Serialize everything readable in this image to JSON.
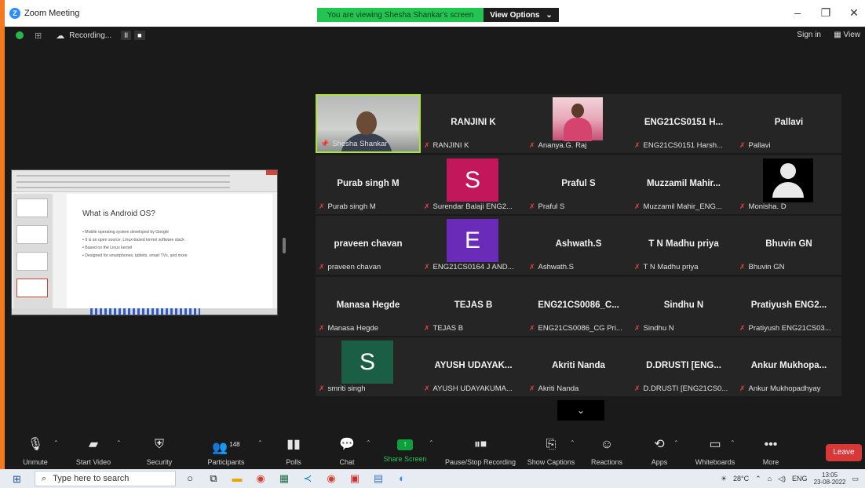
{
  "window": {
    "title": "Zoom Meeting",
    "viewing_banner": "You are viewing Shesha Shankar's screen",
    "view_options": "View Options",
    "controls": {
      "minimize": "–",
      "maximize": "❐",
      "close": "✕"
    }
  },
  "status": {
    "recording": "Recording...",
    "pause": "II",
    "stop": "■",
    "signin": "Sign in",
    "view": "View"
  },
  "shared_screen": {
    "slide_title": "What is Android OS?",
    "bullets": [
      "Mobile operating system developed by Google",
      "It is an open source, Linux-based kernel software stack",
      "Based on the Linux kernel",
      "Designed for smartphones, tablets, smart TVs, and more"
    ]
  },
  "participants": [
    {
      "name": "",
      "label": "Shesha Shankar",
      "type": "video-person",
      "active": true
    },
    {
      "name": "RANJINI K",
      "label": "RANJINI K",
      "type": "name"
    },
    {
      "name": "",
      "label": "Ananya.G. Raj",
      "type": "video-small"
    },
    {
      "name": "ENG21CS0151 H...",
      "label": "ENG21CS0151 Harsh...",
      "type": "name"
    },
    {
      "name": "Pallavi",
      "label": "Pallavi",
      "type": "name"
    },
    {
      "name": "Purab singh M",
      "label": "Purab singh M",
      "type": "name"
    },
    {
      "name": "S",
      "label": "Surendar Balaji ENG2...",
      "type": "letter",
      "color": "#c2185b"
    },
    {
      "name": "Praful S",
      "label": "Praful S",
      "type": "name"
    },
    {
      "name": "Muzzamil Mahir...",
      "label": "Muzzamil Mahir_ENG...",
      "type": "name"
    },
    {
      "name": "",
      "label": "Monisha. D",
      "type": "silhouette"
    },
    {
      "name": "praveen chavan",
      "label": "praveen chavan",
      "type": "name"
    },
    {
      "name": "E",
      "label": "ENG21CS0164 J AND...",
      "type": "letter",
      "color": "#6a2bb8"
    },
    {
      "name": "Ashwath.S",
      "label": "Ashwath.S",
      "type": "name"
    },
    {
      "name": "T N Madhu priya",
      "label": "T N Madhu priya",
      "type": "name"
    },
    {
      "name": "Bhuvin GN",
      "label": "Bhuvin GN",
      "type": "name"
    },
    {
      "name": "Manasa Hegde",
      "label": "Manasa Hegde",
      "type": "name"
    },
    {
      "name": "TEJAS B",
      "label": "TEJAS B",
      "type": "name"
    },
    {
      "name": "ENG21CS0086_C...",
      "label": "ENG21CS0086_CG Pri...",
      "type": "name"
    },
    {
      "name": "Sindhu N",
      "label": "Sindhu N",
      "type": "name"
    },
    {
      "name": "Pratiyush ENG2...",
      "label": "Pratiyush ENG21CS03...",
      "type": "name"
    },
    {
      "name": "S",
      "label": "smriti singh",
      "type": "letter",
      "color": "#1b5e46"
    },
    {
      "name": "AYUSH UDAYAK...",
      "label": "AYUSH UDAYAKUMA...",
      "type": "name"
    },
    {
      "name": "Akriti Nanda",
      "label": "Akriti Nanda",
      "type": "name"
    },
    {
      "name": "D.DRUSTI [ENG...",
      "label": "D.DRUSTI [ENG21CS0...",
      "type": "name"
    },
    {
      "name": "Ankur Mukhopa...",
      "label": "Ankur Mukhopadhyay",
      "type": "name"
    }
  ],
  "toolbar": {
    "unmute": "Unmute",
    "start_video": "Start Video",
    "security": "Security",
    "participants": "Participants",
    "participants_count": "148",
    "polls": "Polls",
    "chat": "Chat",
    "share_screen": "Share Screen",
    "pause_recording": "Pause/Stop Recording",
    "show_captions": "Show Captions",
    "reactions": "Reactions",
    "apps": "Apps",
    "whiteboards": "Whiteboards",
    "more": "More",
    "leave": "Leave",
    "more_chevron": "⌄"
  },
  "taskbar": {
    "search_placeholder": "Type here to search",
    "temperature": "28°C",
    "language": "ENG",
    "time": "13:05",
    "date": "23-08-2022"
  },
  "colors": {
    "banner": "#23c552",
    "active_tile": "#a8e23c",
    "leave": "#d93838",
    "mic_off": "#e3443d"
  }
}
